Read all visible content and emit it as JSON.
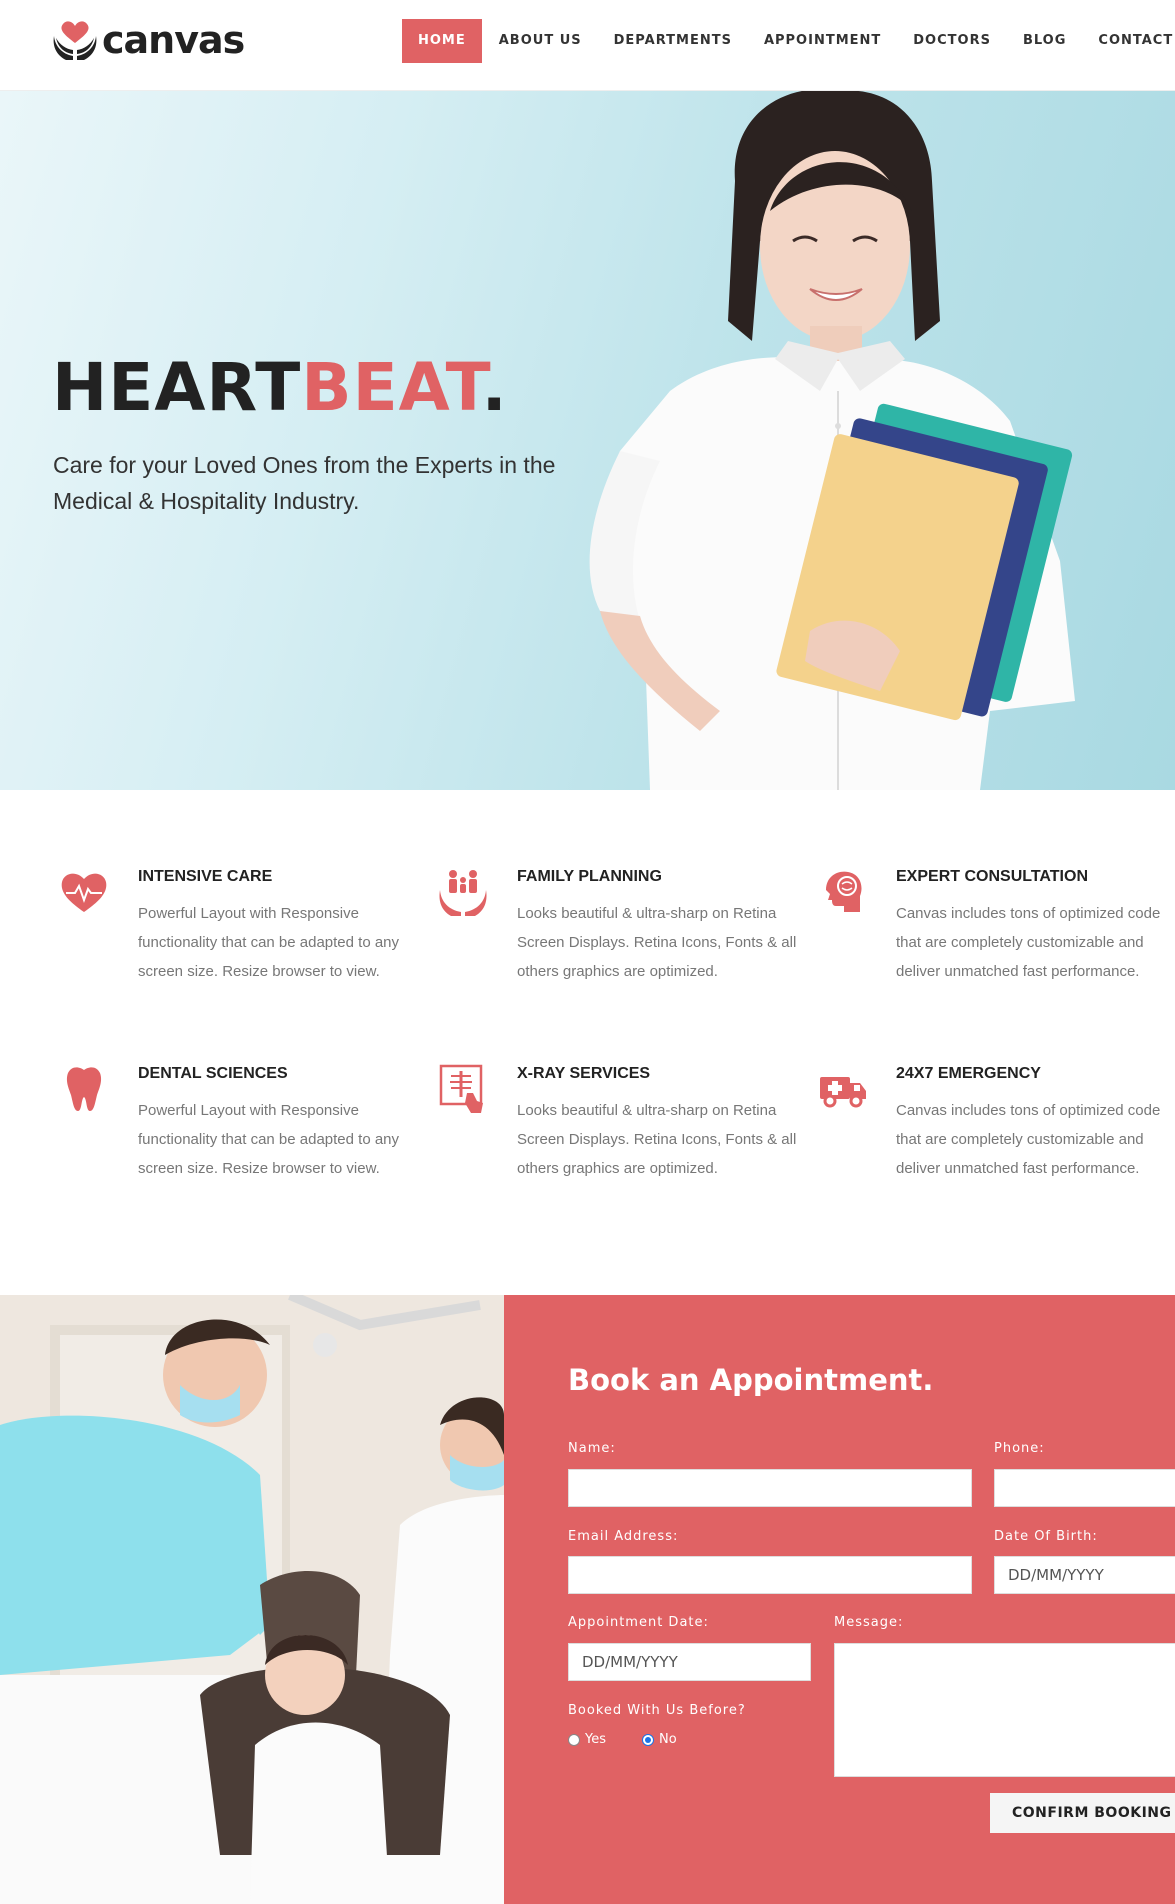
{
  "brand": {
    "name": "canvas",
    "accent": "#e06264"
  },
  "nav": {
    "items": [
      "HOME",
      "ABOUT US",
      "DEPARTMENTS",
      "APPOINTMENT",
      "DOCTORS",
      "BLOG",
      "CONTACT"
    ],
    "active": "HOME"
  },
  "hero": {
    "title_main": "HEART",
    "title_accent": "BEAT",
    "title_end": ".",
    "subtitle": "Care for your Loved Ones from the Experts in the Medical & Hospitality Industry."
  },
  "services": [
    {
      "icon": "heart-pulse-icon",
      "title": "INTENSIVE CARE",
      "text": "Powerful Layout with Responsive functionality that can be adapted to any screen size. Resize browser to view."
    },
    {
      "icon": "family-hands-icon",
      "title": "FAMILY PLANNING",
      "text": "Looks beautiful & ultra-sharp on Retina Screen Displays. Retina Icons, Fonts & all others graphics are optimized."
    },
    {
      "icon": "head-brain-icon",
      "title": "EXPERT CONSULTATION",
      "text": "Canvas includes tons of optimized code that are completely customizable and deliver unmatched fast performance."
    },
    {
      "icon": "tooth-icon",
      "title": "DENTAL SCIENCES",
      "text": "Powerful Layout with Responsive functionality that can be adapted to any screen size. Resize browser to view."
    },
    {
      "icon": "xray-icon",
      "title": "X-RAY SERVICES",
      "text": "Looks beautiful & ultra-sharp on Retina Screen Displays. Retina Icons, Fonts & all others graphics are optimized."
    },
    {
      "icon": "ambulance-icon",
      "title": "24X7 EMERGENCY",
      "text": "Canvas includes tons of optimized code that are completely customizable and deliver unmatched fast performance."
    }
  ],
  "appointment": {
    "title": "Book an Appointment.",
    "name_label": "Name:",
    "phone_label": "Phone:",
    "email_label": "Email Address:",
    "dob_label": "Date Of Birth:",
    "dob_placeholder": "DD/MM/YYYY",
    "appt_date_label": "Appointment Date:",
    "appt_date_placeholder": "DD/MM/YYYY",
    "message_label": "Message:",
    "booked_before_label": "Booked With Us Before?",
    "yes_label": "Yes",
    "no_label": "No",
    "booked_before_value": "No",
    "confirm_label": "CONFIRM BOOKING"
  }
}
